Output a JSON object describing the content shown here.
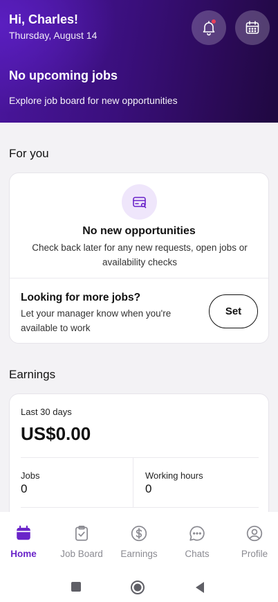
{
  "header": {
    "greeting": "Hi, Charles!",
    "date": "Thursday, August 14",
    "no_jobs_title": "No upcoming jobs",
    "explore_text": "Explore job board for new opportunities",
    "bell_icon": "bell-icon",
    "calendar_icon": "calendar-icon",
    "notification_dot_color": "#e9405a"
  },
  "for_you": {
    "title": "For you",
    "icon": "card-search-icon",
    "opp_title": "No new opportunities",
    "opp_desc": "Check back later for any new requests, open jobs or availability checks",
    "more_title": "Looking for more jobs?",
    "more_desc": "Let your manager know when you're available to work",
    "set_label": "Set"
  },
  "earnings": {
    "title": "Earnings",
    "period": "Last 30 days",
    "amount": "US$0.00",
    "jobs_label": "Jobs",
    "jobs_value": "0",
    "hours_label": "Working hours",
    "hours_value": "0"
  },
  "tabs": [
    {
      "label": "Home",
      "icon": "calendar-filled-icon",
      "active": true
    },
    {
      "label": "Job Board",
      "icon": "clipboard-check-icon",
      "active": false
    },
    {
      "label": "Earnings",
      "icon": "dollar-circle-icon",
      "active": false
    },
    {
      "label": "Chats",
      "icon": "chat-bubble-icon",
      "active": false
    },
    {
      "label": "Profile",
      "icon": "user-circle-icon",
      "active": false
    }
  ],
  "colors": {
    "accent": "#6a24c9",
    "hero_dark": "#2a0a55",
    "hero_light": "#5a1ec0",
    "icon_bg": "#efe6fb"
  },
  "system_nav": [
    "recents-square-icon",
    "home-circle-icon",
    "back-triangle-icon"
  ]
}
